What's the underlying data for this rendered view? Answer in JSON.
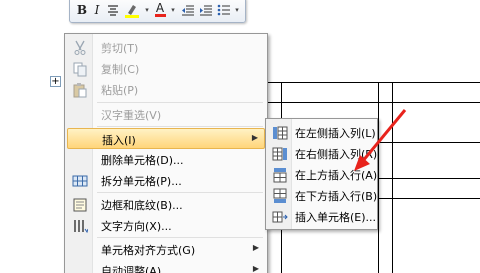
{
  "mini_toolbar": {
    "bold": "B",
    "italic": "I",
    "font_color": "A",
    "dropdown": "▾"
  },
  "context_menu": {
    "items": [
      {
        "label": "剪切(T)",
        "enabled": false,
        "icon": "scissors-icon"
      },
      {
        "label": "复制(C)",
        "enabled": false,
        "icon": "copy-icon"
      },
      {
        "label": "粘贴(P)",
        "enabled": false,
        "icon": "paste-icon"
      },
      {
        "label": "汉字重选(V)",
        "enabled": false,
        "icon": ""
      },
      {
        "label": "插入(I)",
        "enabled": true,
        "highlighted": true,
        "submenu": true,
        "icon": ""
      },
      {
        "label": "删除单元格(D)...",
        "enabled": true,
        "icon": ""
      },
      {
        "label": "拆分单元格(P)...",
        "enabled": true,
        "icon": "split-cells-icon"
      },
      {
        "label": "边框和底纹(B)...",
        "enabled": true,
        "icon": "borders-icon"
      },
      {
        "label": "文字方向(X)...",
        "enabled": true,
        "icon": "text-direction-icon"
      },
      {
        "label": "单元格对齐方式(G)",
        "enabled": true,
        "submenu": true,
        "icon": ""
      },
      {
        "label": "自动调整(A)",
        "enabled": true,
        "submenu": true,
        "icon": ""
      }
    ],
    "submenu_arrow": "▶"
  },
  "insert_submenu": {
    "items": [
      {
        "label": "在左侧插入列(L)",
        "icon": "insert-col-left-icon"
      },
      {
        "label": "在右侧插入列(R)",
        "icon": "insert-col-right-icon"
      },
      {
        "label": "在上方插入行(A)",
        "icon": "insert-row-above-icon"
      },
      {
        "label": "在下方插入行(B)",
        "icon": "insert-row-below-icon"
      },
      {
        "label": "插入单元格(E)...",
        "icon": "insert-cells-icon"
      }
    ]
  },
  "table_move_handle": "+",
  "colors": {
    "highlight_top": "#fff2c5",
    "highlight_bottom": "#ffd57a",
    "annotation_arrow": "#e8231c",
    "menu_border": "#979797",
    "disabled_text": "#9d9d9d"
  }
}
